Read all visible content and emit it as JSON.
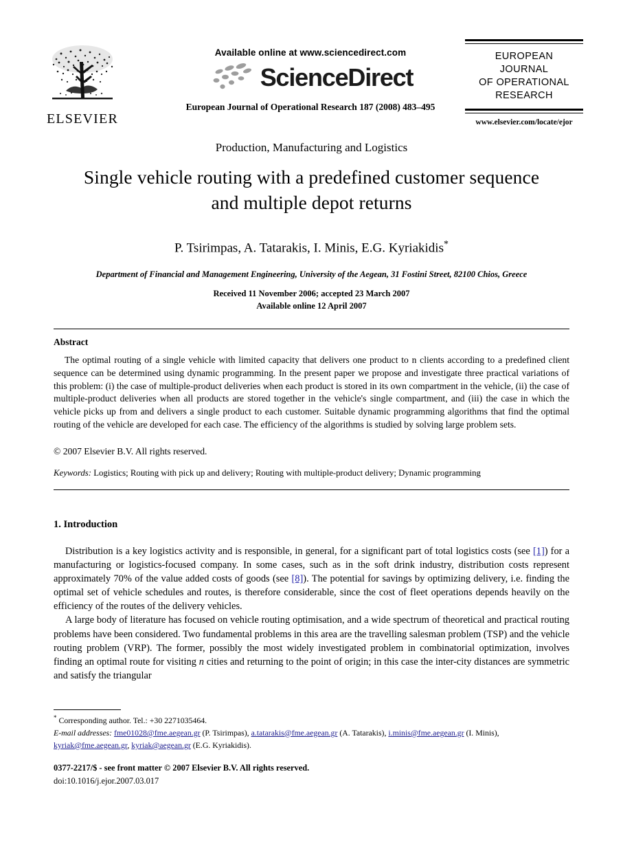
{
  "publisher": {
    "logo_word": "ELSEVIER",
    "tree_icon": "elsevier-tree-icon"
  },
  "sciencedirect": {
    "available_line": "Available online at www.sciencedirect.com",
    "wordmark": "ScienceDirect",
    "swoosh_icon": "sciencedirect-swoosh-icon",
    "journal_citation": "European Journal of Operational Research 187 (2008) 483–495"
  },
  "journal_badge": {
    "line1": "EUROPEAN",
    "line2": "JOURNAL",
    "line3": "OF OPERATIONAL",
    "line4": "RESEARCH",
    "url": "www.elsevier.com/locate/ejor"
  },
  "article": {
    "section_kicker": "Production, Manufacturing and Logistics",
    "title_line1": "Single vehicle routing with a predefined customer sequence",
    "title_line2": "and multiple depot returns",
    "authors": "P. Tsirimpas, A. Tatarakis, I. Minis, E.G. Kyriakidis",
    "corresponding_marker": "*",
    "affiliation": "Department of Financial and Management Engineering, University of the Aegean, 31 Fostini Street, 82100 Chios, Greece",
    "received_line": "Received 11 November 2006; accepted 23 March 2007",
    "online_line": "Available online 12 April 2007"
  },
  "abstract": {
    "heading": "Abstract",
    "body": "The optimal routing of a single vehicle with limited capacity that delivers one product to n clients according to a predefined client sequence can be determined using dynamic programming. In the present paper we propose and investigate three practical variations of this problem: (i) the case of multiple-product deliveries when each product is stored in its own compartment in the vehicle, (ii) the case of multiple-product deliveries when all products are stored together in the vehicle's single compartment, and (iii) the case in which the vehicle picks up from and delivers a single product to each customer. Suitable dynamic programming algorithms that find the optimal routing of the vehicle are developed for each case. The efficiency of the algorithms is studied by solving large problem sets.",
    "copyright": "© 2007 Elsevier B.V. All rights reserved."
  },
  "keywords": {
    "label": "Keywords:",
    "value": "Logistics; Routing with pick up and delivery; Routing with multiple-product delivery; Dynamic programming"
  },
  "introduction": {
    "heading": "1. Introduction",
    "para1_a": "Distribution is a key logistics activity and is responsible, in general, for a significant part of total logistics costs (see ",
    "ref1": "[1]",
    "para1_b": ") for a manufacturing or logistics-focused company. In some cases, such as in the soft drink industry, distribution costs represent approximately 70% of the value added costs of goods (see ",
    "ref8": "[8]",
    "para1_c": "). The potential for savings by optimizing delivery, i.e. finding the optimal set of vehicle schedules and routes, is therefore considerable, since the cost of fleet operations depends heavily on the efficiency of the routes of the delivery vehicles.",
    "para2_a": "A large body of literature has focused on vehicle routing optimisation, and a wide spectrum of theoretical and practical routing problems have been considered. Two fundamental problems in this area are the travelling salesman problem (TSP) and the vehicle routing problem (VRP). The former, possibly the most widely investigated problem in combinatorial optimization, involves finding an optimal route for visiting ",
    "para2_n": "n",
    "para2_b": " cities and returning to the point of origin; in this case the inter-city distances are symmetric and satisfy the triangular"
  },
  "footnotes": {
    "star": "*",
    "corresponding": "Corresponding author. Tel.: +30 2271035464.",
    "email_label": "E-mail addresses:",
    "emails": [
      {
        "address": "fme01028@fme.aegean.gr",
        "owner": "(P. Tsirimpas),"
      },
      {
        "address": "a.tatarakis@fme.aegean.gr",
        "owner": "(A. Tatarakis),"
      },
      {
        "address": "i.minis@fme.aegean.gr",
        "owner": "(I. Minis),"
      },
      {
        "address": "kyriak@fme.aegean.gr",
        "owner": ","
      },
      {
        "address": "kyriak@aegean.gr",
        "owner": "(E.G. Kyriakidis)."
      }
    ]
  },
  "imprint": {
    "line1_bold": "0377-2217/$ - see front matter © 2007 Elsevier B.V. All rights reserved.",
    "line2": "doi:10.1016/j.ejor.2007.03.017"
  },
  "colors": {
    "link": "#2222aa",
    "email": "#1a1a8c",
    "text": "#000000",
    "background": "#ffffff"
  }
}
